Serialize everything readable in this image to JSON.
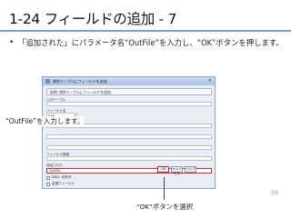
{
  "slide": {
    "title": "1-24  フィールドの追加 - 7",
    "bullet": "「追加された」にパラメータ名“OutFile”を入力し、“OK”ボタンを押します。",
    "callout_left": "“OutFile”を入力します。",
    "callout_bottom": "“OK”ボタンを選択",
    "page_number": "29"
  },
  "dialog": {
    "title": "属性テーブルにフィールドを追加",
    "heading": "説明: 属性テーブルにフィールドを追加",
    "field_labels": [
      "入力テーブル",
      "フィールド名",
      "フィールド型",
      "",
      "",
      "フィールド精度",
      "",
      "追加された"
    ],
    "short_box_text": "Long",
    "output_value": "OutFile",
    "checks": [
      "NULL を許可",
      "必須フィールド"
    ],
    "buttons": {
      "ok": "OK",
      "cancel": "キャンセル",
      "help": "ヘルプ"
    }
  }
}
